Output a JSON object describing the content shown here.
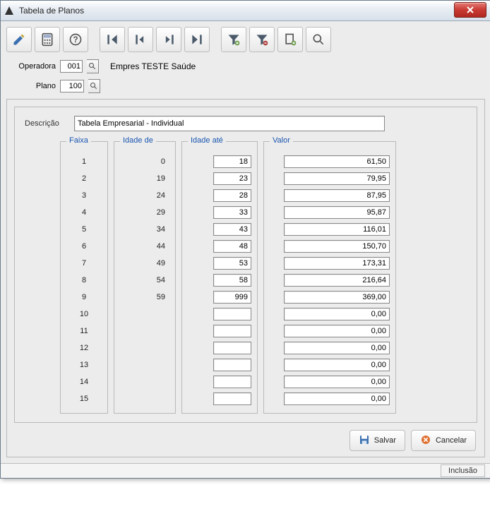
{
  "window": {
    "title": "Tabela de Planos"
  },
  "labels": {
    "operadora": "Operadora",
    "plano": "Plano",
    "descricao": "Descrição",
    "faixa": "Faixa",
    "idade_de": "Idade de",
    "idade_ate": "Idade até",
    "valor": "Valor",
    "salvar": "Salvar",
    "cancelar": "Cancelar"
  },
  "form": {
    "operadora": "001",
    "plano": "100",
    "empresa": "Empres TESTE Saúde",
    "descricao": "Tabela Empresarial - Individual"
  },
  "rows": [
    {
      "faixa": "1",
      "de": "0",
      "ate": "18",
      "valor": "61,50"
    },
    {
      "faixa": "2",
      "de": "19",
      "ate": "23",
      "valor": "79,95"
    },
    {
      "faixa": "3",
      "de": "24",
      "ate": "28",
      "valor": "87,95"
    },
    {
      "faixa": "4",
      "de": "29",
      "ate": "33",
      "valor": "95,87"
    },
    {
      "faixa": "5",
      "de": "34",
      "ate": "43",
      "valor": "116,01"
    },
    {
      "faixa": "6",
      "de": "44",
      "ate": "48",
      "valor": "150,70"
    },
    {
      "faixa": "7",
      "de": "49",
      "ate": "53",
      "valor": "173,31"
    },
    {
      "faixa": "8",
      "de": "54",
      "ate": "58",
      "valor": "216,64"
    },
    {
      "faixa": "9",
      "de": "59",
      "ate": "999",
      "valor": "369,00"
    },
    {
      "faixa": "10",
      "de": "",
      "ate": "",
      "valor": "0,00"
    },
    {
      "faixa": "11",
      "de": "",
      "ate": "",
      "valor": "0,00"
    },
    {
      "faixa": "12",
      "de": "",
      "ate": "",
      "valor": "0,00"
    },
    {
      "faixa": "13",
      "de": "",
      "ate": "",
      "valor": "0,00"
    },
    {
      "faixa": "14",
      "de": "",
      "ate": "",
      "valor": "0,00"
    },
    {
      "faixa": "15",
      "de": "",
      "ate": "",
      "valor": "0,00"
    }
  ],
  "status": "Inclusão",
  "toolbar_icons": [
    "edit",
    "calculator",
    "help",
    "first",
    "prev",
    "next",
    "last",
    "filter-add",
    "filter-remove",
    "new-record",
    "search"
  ]
}
